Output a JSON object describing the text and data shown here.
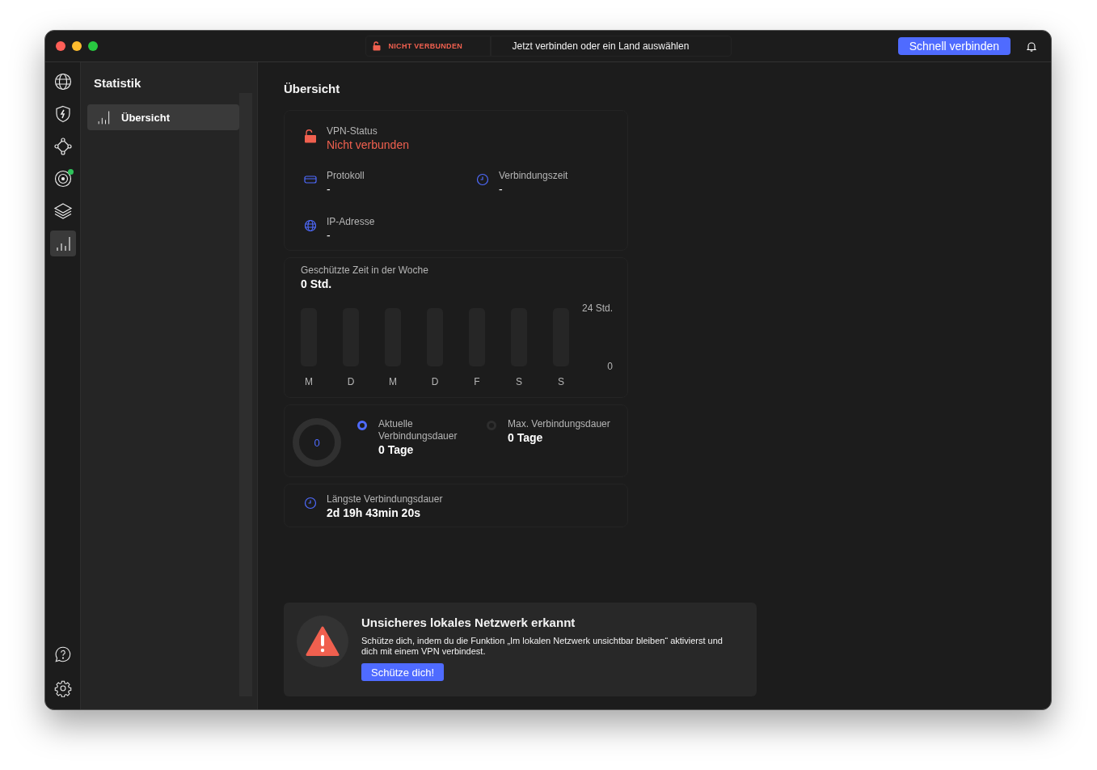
{
  "window": {
    "traffic_lights": [
      {
        "color": "#ff5f57"
      },
      {
        "color": "#febc2e"
      },
      {
        "color": "#28c840"
      }
    ]
  },
  "titlebar": {
    "status": "NICHT VERBUNDEN",
    "connect_prompt": "Jetzt verbinden oder ein Land auswählen",
    "quick_connect": "Schnell verbinden"
  },
  "rail": {
    "items": [
      {
        "kind": "globe",
        "selected": false,
        "badge": false
      },
      {
        "kind": "shield",
        "selected": false,
        "badge": false
      },
      {
        "kind": "nodes",
        "selected": false,
        "badge": false
      },
      {
        "kind": "target",
        "selected": false,
        "badge": true
      },
      {
        "kind": "layers",
        "selected": false,
        "badge": false
      },
      {
        "kind": "stats",
        "selected": true,
        "badge": false
      }
    ],
    "bottom": [
      {
        "kind": "help"
      },
      {
        "kind": "settings"
      }
    ]
  },
  "sidebar": {
    "title": "Statistik",
    "items": [
      {
        "label": "Übersicht",
        "selected": true
      }
    ]
  },
  "main": {
    "title": "Übersicht",
    "vpn_status": {
      "label": "VPN-Status",
      "value": "Nicht verbunden",
      "connected": false
    },
    "details": [
      {
        "kind": "protocol",
        "label": "Protokoll",
        "value": "-"
      },
      {
        "kind": "clock",
        "label": "Verbindungszeit",
        "value": "-"
      },
      {
        "kind": "globe",
        "label": "IP-Adresse",
        "value": "-"
      }
    ],
    "weekly": {
      "label": "Geschützte Zeit in der Woche",
      "total": "0 Std.",
      "chart_data": {
        "type": "bar",
        "categories": [
          "M",
          "D",
          "M",
          "D",
          "F",
          "S",
          "S"
        ],
        "series": [
          {
            "color": "#262626",
            "values": [
              24,
              24,
              24,
              24,
              24,
              24,
              24
            ]
          },
          {
            "color": "#4f6bff",
            "values": [
              0,
              0,
              0,
              0,
              0,
              0,
              0
            ]
          }
        ],
        "ylim": [
          0,
          24
        ],
        "yticks": [
          0,
          {
            "value": 24,
            "label": "24 Std."
          }
        ]
      }
    },
    "duration": {
      "ring_value": "0",
      "legend": [
        {
          "label": "Aktuelle Verbindungsdauer",
          "value": "0 Tage",
          "color": "#4f6bff"
        },
        {
          "label": "Max. Verbindungsdauer",
          "value": "0 Tage",
          "color": "#2e2e2e"
        }
      ]
    },
    "longest": {
      "label": "Längste Verbindungsdauer",
      "value": "2d 19h 43min 20s"
    },
    "alert": {
      "title": "Unsicheres lokales Netzwerk erkannt",
      "text": "Schütze dich, indem du die Funktion „Im lokalen Netzwerk unsichtbar bleiben“ aktivierst und dich mit einem VPN verbindest.",
      "button": "Schütze dich!"
    }
  }
}
